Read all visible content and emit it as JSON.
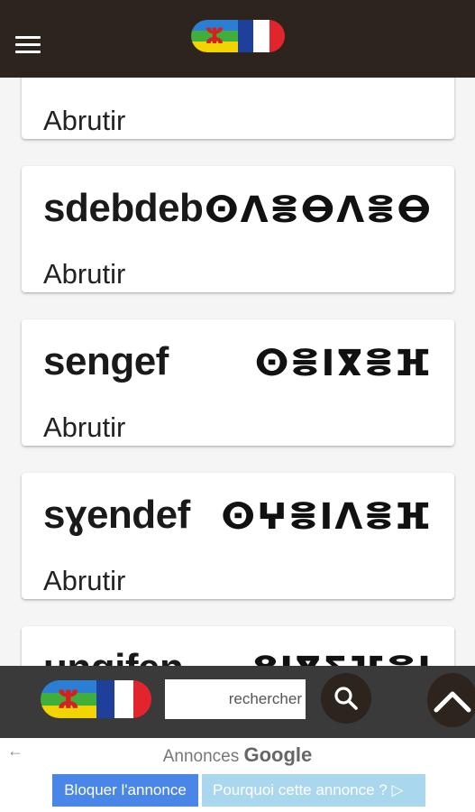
{
  "header": {
    "menu_icon": "hamburger-icon",
    "flag_icon": "amazigh-french-flag-icon",
    "yaz_glyph": "ⵣ"
  },
  "entries": [
    {
      "kabyle": "",
      "tifinagh": "",
      "french": "Abrutir"
    },
    {
      "kabyle": "sdebdeb",
      "tifinagh": "ⵙⴷⴻⴱⴷⴻⴱ",
      "french": "Abrutir"
    },
    {
      "kabyle": "sengef",
      "tifinagh": "ⵙⴻⵏⴳⴻⴼ",
      "french": "Abrutir"
    },
    {
      "kabyle": "sɣendef",
      "tifinagh": "ⵙⵖⴻⵏⴷⴻⴼ",
      "french": "Abrutir"
    },
    {
      "kabyle": "ungifen",
      "tifinagh": "ⵓⵏⴳⵉⴼⴻⵏ",
      "french": ""
    }
  ],
  "search": {
    "placeholder": "rechercher",
    "search_icon": "search-icon",
    "scroll_top_icon": "chevron-up-icon"
  },
  "ad": {
    "title_prefix": "Annonces",
    "title_brand": "Google",
    "block_label": "Bloquer l'annonce",
    "why_label": "Pourquoi cette annonce ? ▷",
    "back_glyph": "←"
  },
  "colors": {
    "header_bg": "#2d241d",
    "bottom_bg": "#3a3a3a",
    "ad_block": "#4a86e8",
    "ad_why": "#a9d8ee"
  }
}
